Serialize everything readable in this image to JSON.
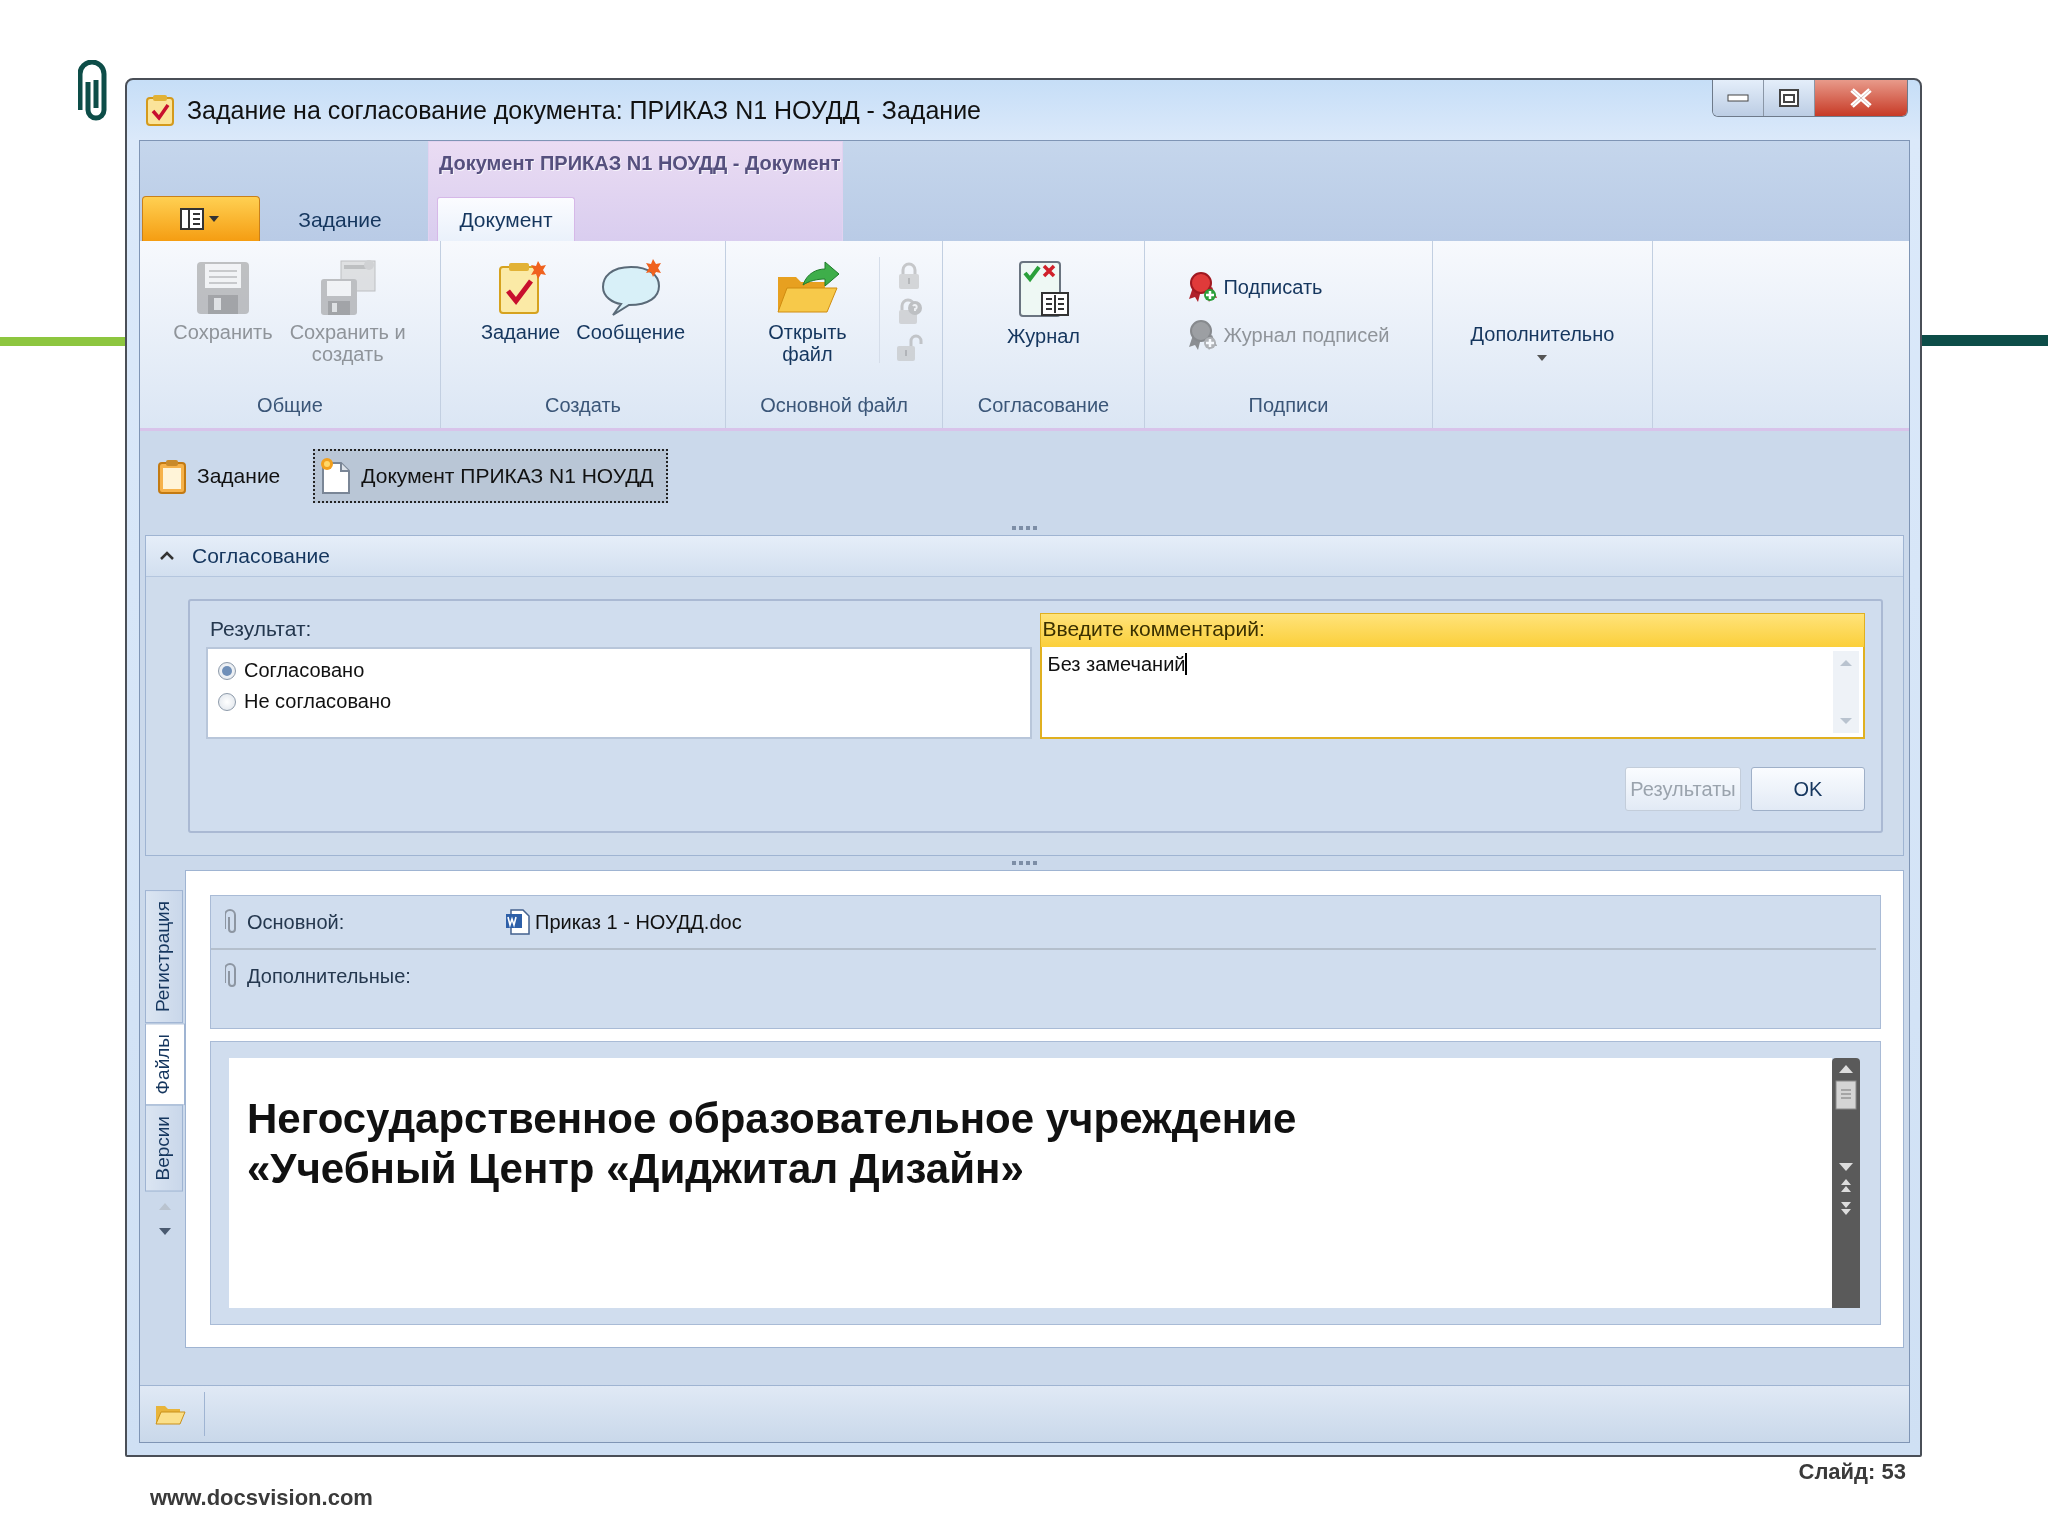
{
  "window": {
    "title": "Задание на согласование документа: ПРИКАЗ N1 НОУДД - Задание"
  },
  "ribbon": {
    "contextual_title": "Документ ПРИКАЗ N1 НОУДД - Документ",
    "tabs": [
      {
        "label": "Задание",
        "selected": false
      },
      {
        "label": "Документ",
        "selected": true
      }
    ],
    "groups": [
      {
        "label": "Общие",
        "buttons": [
          {
            "kind": "large",
            "label": "Сохранить",
            "disabled": true
          },
          {
            "kind": "large",
            "label": "Сохранить и создать",
            "disabled": true
          }
        ]
      },
      {
        "label": "Создать",
        "buttons": [
          {
            "kind": "large",
            "label": "Задание",
            "disabled": false
          },
          {
            "kind": "large",
            "label": "Сообщение",
            "disabled": false
          }
        ]
      },
      {
        "label": "Основной файл",
        "buttons": [
          {
            "kind": "large",
            "label": "Открыть файл",
            "disabled": false
          },
          {
            "kind": "icon",
            "disabled": true
          },
          {
            "kind": "icon",
            "disabled": true
          },
          {
            "kind": "icon",
            "disabled": true
          }
        ]
      },
      {
        "label": "Согласование",
        "buttons": [
          {
            "kind": "large",
            "label": "Журнал",
            "disabled": false
          }
        ]
      },
      {
        "label": "Подписи",
        "buttons": [
          {
            "kind": "small",
            "label": "Подписать",
            "disabled": false
          },
          {
            "kind": "small",
            "label": "Журнал подписей",
            "disabled": true
          }
        ]
      },
      {
        "buttons": [
          {
            "kind": "dropdown",
            "label": "Дополнительно",
            "disabled": false
          }
        ]
      }
    ]
  },
  "document_tabs": [
    {
      "label": "Задание",
      "selected": false
    },
    {
      "label": "Документ ПРИКАЗ N1 НОУДД",
      "selected": true
    }
  ],
  "approval": {
    "title": "Согласование",
    "expanded": true,
    "result_label": "Результат:",
    "options": [
      {
        "label": "Согласовано",
        "selected": true
      },
      {
        "label": "Не согласовано",
        "selected": false
      }
    ],
    "comment_label": "Введите комментарий:",
    "comment": "Без замечаний",
    "buttons": [
      {
        "label": "Результаты",
        "disabled": true
      },
      {
        "label": "OK",
        "disabled": false
      }
    ]
  },
  "side_tabs": [
    {
      "label": "Регистрация",
      "selected": false
    },
    {
      "label": "Файлы",
      "selected": true
    },
    {
      "label": "Версии",
      "selected": false
    }
  ],
  "files": [
    {
      "label": "Основной:",
      "file": "Приказ 1 - НОУДД.doc"
    },
    {
      "label": "Дополнительные:"
    }
  ],
  "preview": {
    "lines": [
      "Негосударственное образовательное учреждение",
      "«Учебный Центр «Диджитал Дизайн»"
    ]
  },
  "slide": {
    "website": "www.docsvision.com",
    "slide_number": "Слайд: 53"
  }
}
